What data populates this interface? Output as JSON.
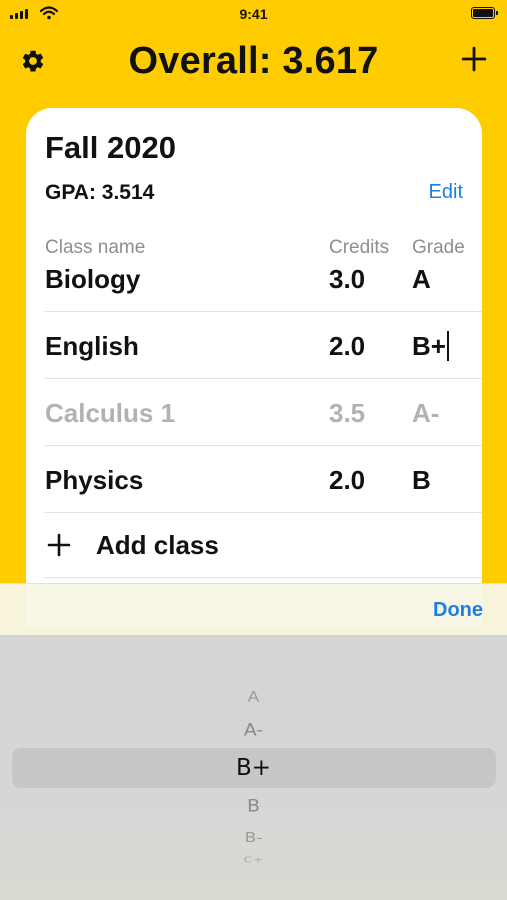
{
  "status_bar": {
    "time": "9:41",
    "icons": [
      "cellular-signal-icon",
      "wifi-icon",
      "battery-icon"
    ]
  },
  "header": {
    "title": "Overall: 3.617",
    "left_icon": "gear-icon",
    "right_icon": "plus-icon"
  },
  "semester": {
    "name": "Fall 2020",
    "gpa": "GPA: 3.514",
    "edit_label": "Edit",
    "columns": {
      "name": "Class name",
      "credits": "Credits",
      "grade": "Grade"
    },
    "classes": [
      {
        "name": "Biology",
        "credits": "3.0",
        "grade": "A"
      },
      {
        "name": "English",
        "credits": "2.0",
        "grade": "B+"
      },
      {
        "name": "Calculus 1",
        "credits": "3.5",
        "grade": "A-"
      },
      {
        "name": "Physics",
        "credits": "2.0",
        "grade": "B"
      }
    ],
    "add_class_label": "Add class"
  },
  "toolbar": {
    "done_label": "Done"
  },
  "picker": {
    "options": [
      "A",
      "A-",
      "B+",
      "B",
      "B-",
      "C+"
    ],
    "selected": "B+"
  },
  "colors": {
    "background": "#FFCC00",
    "accent": "#1E7FE0",
    "muted_text": "#8E8E93"
  }
}
